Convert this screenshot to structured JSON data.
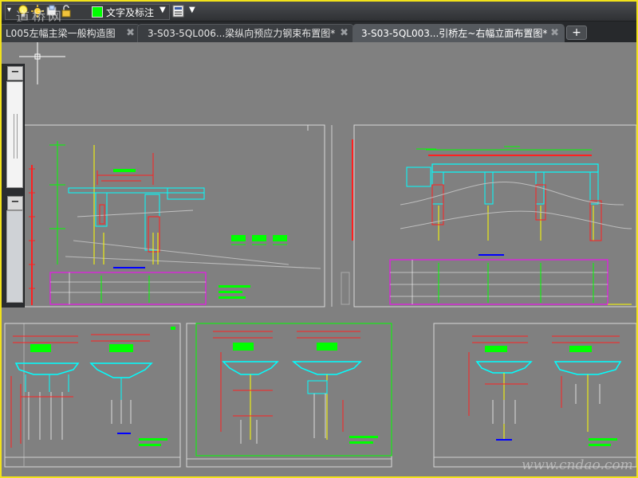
{
  "toolbar": {
    "layer_name": "文字及标注",
    "layer_color": "#00ff00",
    "icons": [
      "menu-arrow-icon",
      "lightbulb-icon",
      "sun-icon",
      "freeze-icon",
      "lock-icon",
      "color-swatch-icon",
      "dropdown-arrow-icon",
      "layer-properties-icon",
      "overflow-arrow-icon"
    ]
  },
  "tabs": [
    {
      "label": "L005左幅主梁一般构造图",
      "active": false
    },
    {
      "label": "3-S03-5QL006...梁纵向预应力钢束布置图*",
      "active": false
    },
    {
      "label": "3-S03-5QL003...引桥左~右幅立面布置图*",
      "active": true
    }
  ],
  "tab_add_label": "+",
  "palette": {
    "collapse_top": "−",
    "collapse_bottom": "−"
  },
  "watermarks": {
    "top_left": "道桥网",
    "bottom_right": "www.cndao.com"
  },
  "colors": {
    "canvas": "#808080",
    "frame": "#f2e21a",
    "red_dim": "#ff2020",
    "green_text": "#00ff00",
    "cyan_struct": "#00ffff",
    "yellow_dim": "#ffff00",
    "magenta_table": "#ff00ff",
    "frame_line": "#c8c8c8"
  }
}
